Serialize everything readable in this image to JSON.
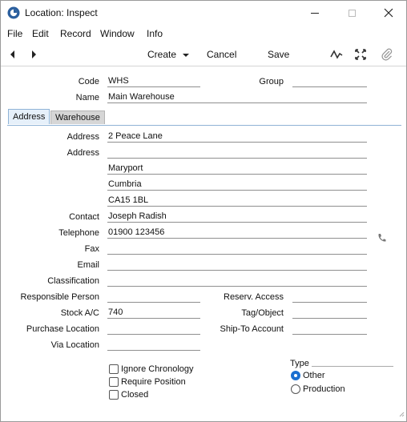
{
  "window": {
    "title": "Location: Inspect"
  },
  "menu": [
    "File",
    "Edit",
    "Record",
    "Window",
    "Info"
  ],
  "toolbar": {
    "create_label": "Create",
    "cancel_label": "Cancel",
    "save_label": "Save"
  },
  "header": {
    "code_label": "Code",
    "code_value": "WHS",
    "group_label": "Group",
    "group_value": "",
    "name_label": "Name",
    "name_value": "Main Warehouse"
  },
  "tabs": [
    {
      "label": "Address",
      "active": true
    },
    {
      "label": "Warehouse",
      "active": false
    }
  ],
  "address": {
    "address_label": "Address",
    "address1": "2 Peace Lane",
    "address2_label": "Address",
    "address2": "",
    "address3": "Maryport",
    "address4": "Cumbria",
    "address5": "CA15 1BL",
    "contact_label": "Contact",
    "contact": "Joseph Radish",
    "telephone_label": "Telephone",
    "telephone": "01900 123456",
    "fax_label": "Fax",
    "fax": "",
    "email_label": "Email",
    "email": "",
    "classification_label": "Classification",
    "classification": "",
    "responsible_label": "Responsible Person",
    "responsible": "",
    "reserv_label": "Reserv. Access",
    "reserv": "",
    "stock_label": "Stock A/C",
    "stock": "740",
    "tag_label": "Tag/Object",
    "tag": "",
    "purchase_label": "Purchase Location",
    "purchase": "",
    "shipto_label": "Ship-To Account",
    "shipto": "",
    "via_label": "Via Location",
    "via": ""
  },
  "options": {
    "ignore_chronology": "Ignore Chronology",
    "require_position": "Require Position",
    "closed": "Closed",
    "type_label": "Type",
    "type_other": "Other",
    "type_production": "Production",
    "type_selected": "Other"
  },
  "colors": {
    "accent": "#1a6fd0",
    "tab_active_bg": "#e6f0fa",
    "tab_inactive_bg": "#d6d6d6"
  }
}
